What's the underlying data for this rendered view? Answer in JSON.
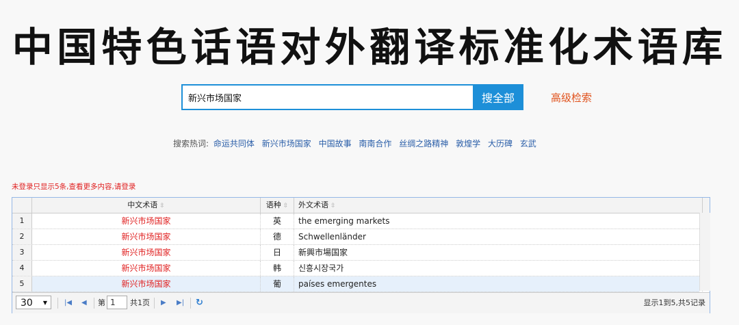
{
  "page": {
    "title": "中国特色话语对外翻译标准化术语库",
    "search_value": "新兴市场国家",
    "search_button": "搜全部",
    "advanced_search": "高级检索",
    "hot_label": "搜索热词:",
    "hot_words": [
      "命运共同体",
      "新兴市场国家",
      "中国故事",
      "南南合作",
      "丝绸之路精神",
      "敦煌学",
      "大历碑",
      "玄武"
    ],
    "notice": "未登录只显示5条,查看更多内容,请登录"
  },
  "table": {
    "columns": [
      "中文术语",
      "语种",
      "外文术语"
    ],
    "rows": [
      {
        "n": "1",
        "zh": "新兴市场国家",
        "lang": "英",
        "foreign": "the emerging markets"
      },
      {
        "n": "2",
        "zh": "新兴市场国家",
        "lang": "德",
        "foreign": "Schwellenländer"
      },
      {
        "n": "3",
        "zh": "新兴市场国家",
        "lang": "日",
        "foreign": "新興市場国家"
      },
      {
        "n": "4",
        "zh": "新兴市场国家",
        "lang": "韩",
        "foreign": "신흥시장국가"
      },
      {
        "n": "5",
        "zh": "新兴市场国家",
        "lang": "葡",
        "foreign": "países emergentes"
      }
    ]
  },
  "pager": {
    "page_size": "30",
    "page_prefix": "第",
    "page_number": "1",
    "page_total": "共1页",
    "summary": "显示1到5,共5记录"
  }
}
